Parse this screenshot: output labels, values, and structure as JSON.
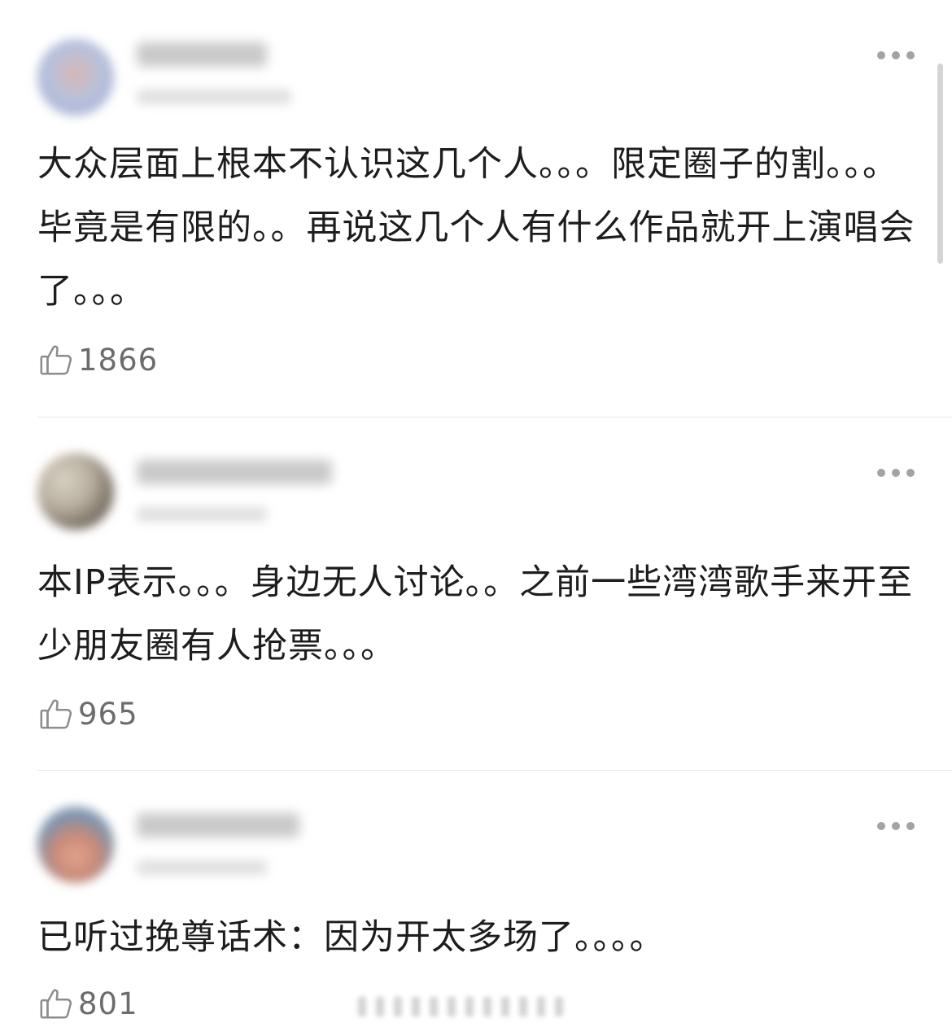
{
  "colors": {
    "text": "#1d1d1d",
    "like_count": "#6c6c6c",
    "icon": "#8c8c8c",
    "divider": "#e6e6e6"
  },
  "icons": {
    "like": "thumbs-up-icon",
    "more": "more-options-icon"
  },
  "comments": [
    {
      "text": "大众层面上根本不认识这几个人。。。限定圈子的割。。。毕竟是有限的。。再说这几个人有什么作品就开上演唱会了。。。",
      "likes": "1866"
    },
    {
      "text": "本IP表示。。。身边无人讨论。。之前一些湾湾歌手来开至少朋友圈有人抢票。。。",
      "likes": "965"
    },
    {
      "text": "已听过挽尊话术：因为开太多场了。。。。",
      "likes": "801"
    }
  ]
}
